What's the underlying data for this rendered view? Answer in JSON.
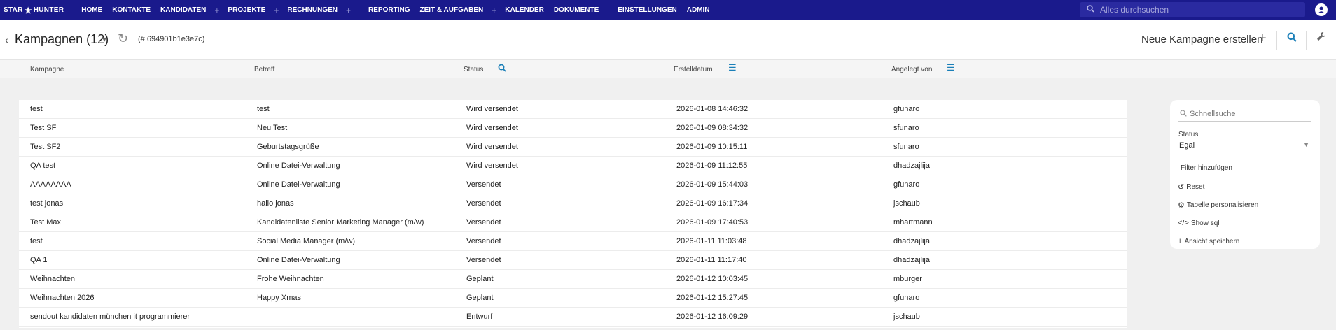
{
  "nav": {
    "logo_left": "STAR",
    "logo_right": "HUNTER",
    "items": [
      "HOME",
      "KONTAKTE",
      "KANDIDATEN",
      "PROJEKTE",
      "RECHNUNGEN",
      "REPORTING",
      "ZEIT & AUFGABEN",
      "KALENDER",
      "DOKUMENTE",
      "EINSTELLUNGEN",
      "ADMIN"
    ],
    "search_placeholder": "Alles durchsuchen"
  },
  "header": {
    "title": "Kampagnen (12)",
    "id_text": "(# 694901b1e3e7c)",
    "new_label": "Neue Kampagne erstellen"
  },
  "columns": [
    "Kampagne",
    "Betreff",
    "Status",
    "Erstelldatum",
    "Angelegt von"
  ],
  "rows": [
    [
      "test",
      "test",
      "Wird versendet",
      "2026-01-08 14:46:32",
      "gfunaro"
    ],
    [
      "Test SF",
      "Neu Test",
      "Wird versendet",
      "2026-01-09 08:34:32",
      "sfunaro"
    ],
    [
      "Test SF2",
      "Geburtstagsgrüße",
      "Wird versendet",
      "2026-01-09 10:15:11",
      "sfunaro"
    ],
    [
      "QA test",
      "Online Datei-Verwaltung",
      "Wird versendet",
      "2026-01-09 11:12:55",
      "dhadzajlija"
    ],
    [
      "AAAAAAAA",
      "Online Datei-Verwaltung",
      "Versendet",
      "2026-01-09 15:44:03",
      "gfunaro"
    ],
    [
      "test jonas",
      "hallo jonas",
      "Versendet",
      "2026-01-09 16:17:34",
      "jschaub"
    ],
    [
      "Test Max",
      "Kandidatenliste Senior Marketing Manager (m/w)",
      "Versendet",
      "2026-01-09 17:40:53",
      "mhartmann"
    ],
    [
      "test",
      "Social Media Manager (m/w)",
      "Versendet",
      "2026-01-11 11:03:48",
      "dhadzajlija"
    ],
    [
      "QA 1",
      "Online Datei-Verwaltung",
      "Versendet",
      "2026-01-11 11:17:40",
      "dhadzajlija"
    ],
    [
      "Weihnachten",
      "Frohe Weihnachten",
      "Geplant",
      "2026-01-12 10:03:45",
      "mburger"
    ],
    [
      "Weihnachten 2026",
      "Happy Xmas",
      "Geplant",
      "2026-01-12 15:27:45",
      "gfunaro"
    ],
    [
      "sendout kandidaten münchen it programmierer",
      "",
      "Entwurf",
      "2026-01-12 16:09:29",
      "jschaub"
    ]
  ],
  "panel": {
    "quick_search_placeholder": "Schnellsuche",
    "status_label": "Status",
    "status_value": "Egal",
    "add_filter": "Filter hinzufügen",
    "reset": "Reset",
    "personalize": "Tabelle personalisieren",
    "show_sql": "Show sql",
    "save_view": "Ansicht speichern"
  },
  "icons": {
    "back": "chevron-left-icon",
    "reload": "reload-icon",
    "search": "search-icon",
    "menu": "menu-icon",
    "wrench": "wrench-icon",
    "user": "user-icon"
  },
  "colors": {
    "nav_bg": "#1a1a8c",
    "accent": "#1a7fb8"
  }
}
